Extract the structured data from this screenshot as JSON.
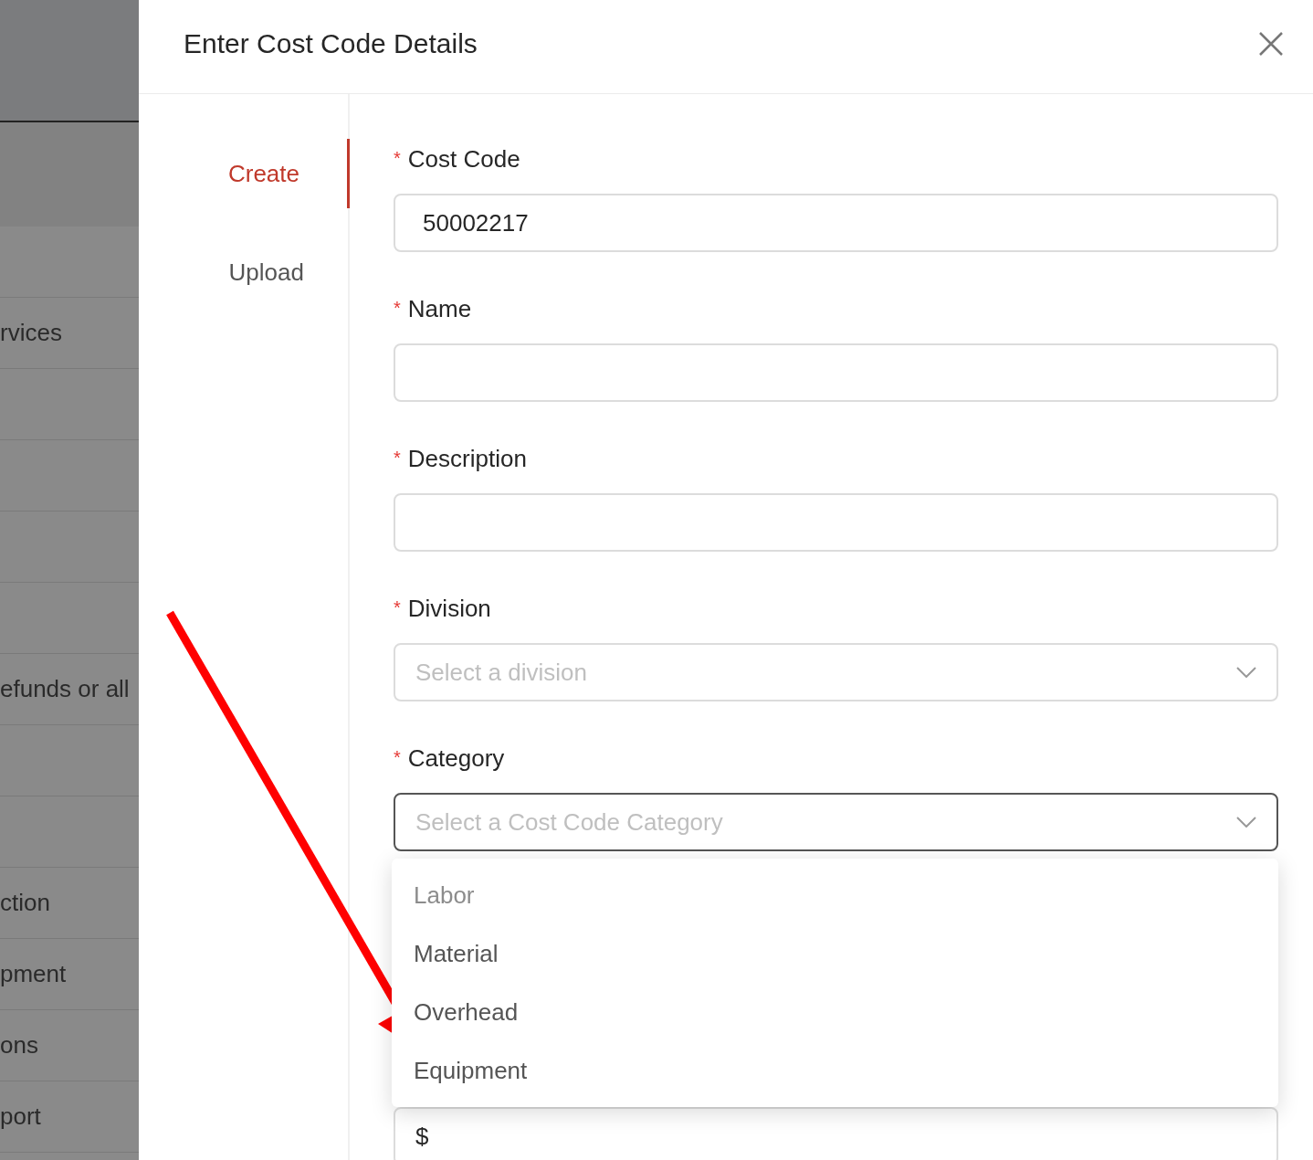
{
  "background_list": {
    "rows": [
      {},
      {
        "text": "rvices"
      },
      {},
      {},
      {},
      {},
      {
        "text": "efunds or all"
      },
      {},
      {},
      {
        "text": "ction"
      },
      {
        "text": "pment"
      },
      {
        "text": "ons"
      },
      {
        "text": "port"
      }
    ]
  },
  "drawer": {
    "title": "Enter Cost Code Details",
    "tabs": [
      {
        "label": "Create",
        "selected": true
      },
      {
        "label": "Upload",
        "selected": false
      }
    ],
    "fields": [
      {
        "kind": "text",
        "label": "Cost Code",
        "required_mark": "*",
        "value": "50002217",
        "focused": false
      },
      {
        "kind": "text",
        "label": "Name",
        "required_mark": "*",
        "focused": false
      },
      {
        "kind": "text",
        "label": "Description",
        "required_mark": "*",
        "focused": false
      },
      {
        "kind": "select",
        "label": "Division",
        "required_mark": "*",
        "placeholder": "Select a division",
        "focused": false
      },
      {
        "kind": "select",
        "label": "Category",
        "required_mark": "*",
        "placeholder": "Select a Cost Code Category",
        "focused": true,
        "options": [
          {
            "label": "Labor",
            "disabled": true
          },
          {
            "label": "Material",
            "disabled": false
          },
          {
            "label": "Overhead",
            "disabled": false
          },
          {
            "label": "Equipment",
            "disabled": false
          }
        ]
      },
      {
        "kind": "covered"
      },
      {
        "kind": "money",
        "prefix": "$"
      }
    ]
  }
}
